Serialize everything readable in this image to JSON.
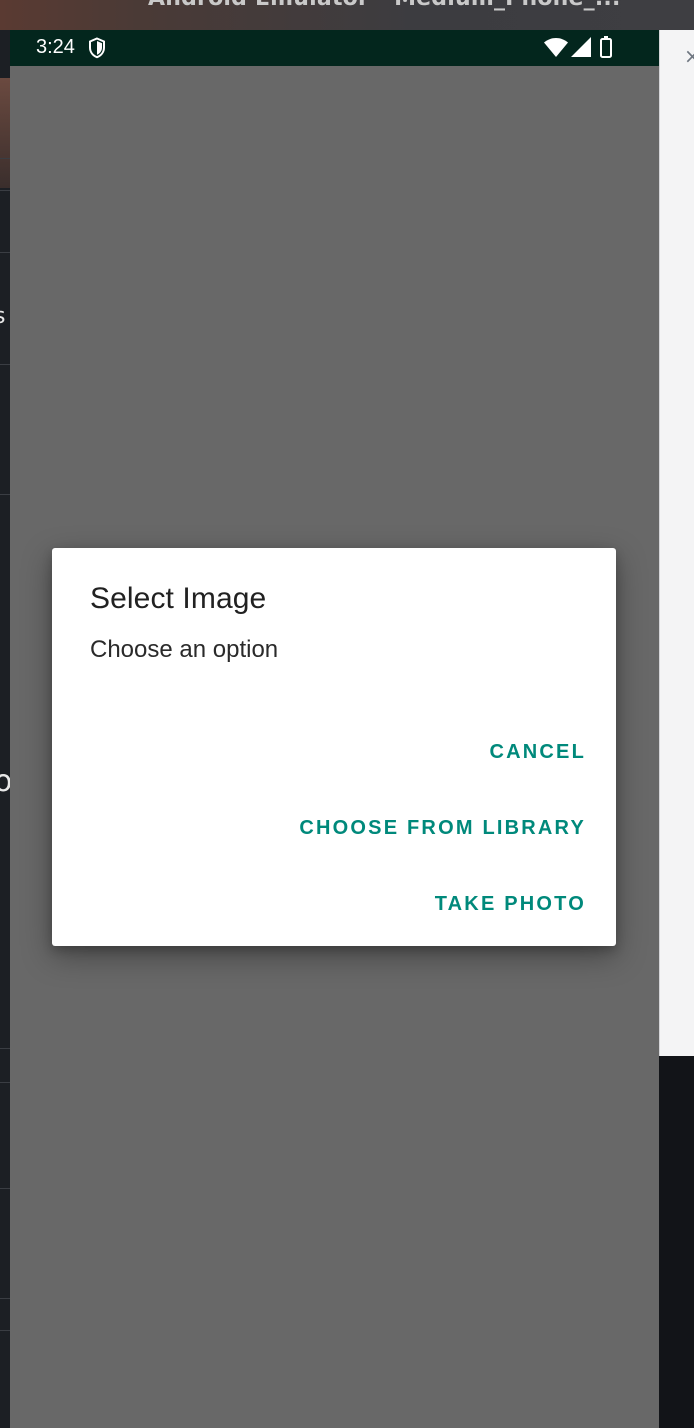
{
  "host": {
    "window_title": "Android Emulator - Medium_Phone_...",
    "close_glyph": "×",
    "left_glyphs": [
      "s",
      "o"
    ]
  },
  "status_bar": {
    "time": "3:24",
    "icons": [
      "shield-icon",
      "wifi-icon",
      "signal-icon",
      "battery-icon"
    ],
    "background": "#03261d"
  },
  "dialog": {
    "title": "Select Image",
    "message": "Choose an option",
    "buttons": {
      "cancel": "CANCEL",
      "choose_from_library": "CHOOSE FROM LIBRARY",
      "take_photo": "TAKE PHOTO"
    },
    "accent_color": "#00897b"
  }
}
